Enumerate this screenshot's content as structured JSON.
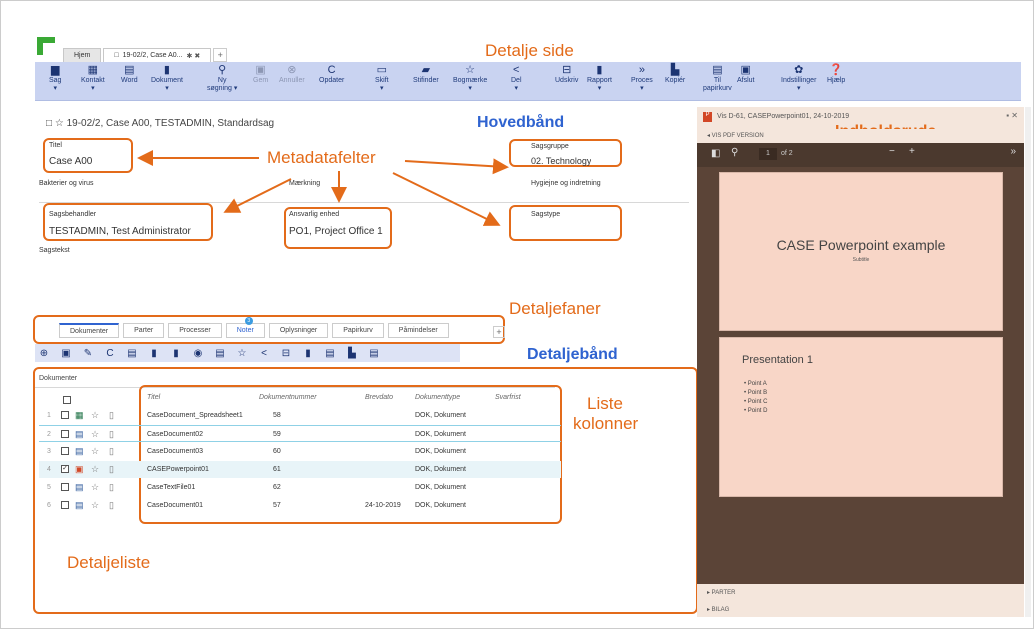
{
  "tabs": {
    "home": "Hjem",
    "active": "19-02/2, Case A0...",
    "pin": "✱ ✖",
    "add": "+"
  },
  "callouts": {
    "detail_page": "Detalje side",
    "main_band": "Hovedbånd",
    "content_pane": "Indholdsrude",
    "metadata": "Metadatafelter",
    "detail_tabs": "Detaljefaner",
    "detail_band": "Detaljebånd",
    "list_columns_1": "Liste",
    "list_columns_2": "kolonner",
    "detail_list": "Detaljeliste"
  },
  "ribbon": [
    {
      "icon": "▆",
      "label": "Sag",
      "l2": "▾"
    },
    {
      "icon": "▦",
      "label": "Kontakt",
      "l2": "▾"
    },
    {
      "icon": "▤",
      "label": "Word",
      "l2": ""
    },
    {
      "icon": "▮",
      "label": "Dokument",
      "l2": "▾"
    },
    {
      "icon": "⚲",
      "label": "Ny",
      "l2": "søgning ▾"
    },
    {
      "icon": "▣",
      "label": "Gem",
      "l2": ""
    },
    {
      "icon": "⊗",
      "label": "Annuller",
      "l2": ""
    },
    {
      "icon": "C",
      "label": "Opdater",
      "l2": ""
    },
    {
      "icon": "▭",
      "label": "Skift",
      "l2": "▾"
    },
    {
      "icon": "▰",
      "label": "Stifinder",
      "l2": ""
    },
    {
      "icon": "☆",
      "label": "Bogmærke",
      "l2": "▾"
    },
    {
      "icon": "<",
      "label": "Del",
      "l2": "▾"
    },
    {
      "icon": "⊟",
      "label": "Udskriv",
      "l2": ""
    },
    {
      "icon": "▮",
      "label": "Rapport",
      "l2": "▾"
    },
    {
      "icon": "»",
      "label": "Proces",
      "l2": "▾"
    },
    {
      "icon": "▙",
      "label": "Kopiér",
      "l2": ""
    },
    {
      "icon": "▤",
      "label": "Til",
      "l2": "papirkurv"
    },
    {
      "icon": "▣",
      "label": "Afslut",
      "l2": ""
    },
    {
      "icon": "✿",
      "label": "Indstillinger",
      "l2": "▾"
    },
    {
      "icon": "❓",
      "label": "Hjælp",
      "l2": ""
    }
  ],
  "case": {
    "folder_icon": "□",
    "star": "☆",
    "title": "19-02/2, Case A00, TESTADMIN, Standardsag"
  },
  "fields": {
    "titel_label": "Titel",
    "titel_value": "Case A00",
    "sagsgruppe_label": "Sagsgruppe",
    "sagsgruppe_value": "02. Technology",
    "bakterier": "Bakterier og virus",
    "maerkning": "Mærkning",
    "hygiejne": "Hygiejne og indretning",
    "sagsbeh_label": "Sagsbehandler",
    "sagsbeh_value": "TESTADMIN, Test Administrator",
    "ansvarlig_label": "Ansvarlig enhed",
    "ansvarlig_value": "PO1, Project Office 1",
    "sagstype_label": "Sagstype",
    "sagstekst": "Sagstekst"
  },
  "detail_tabs": [
    "Dokumenter",
    "Parter",
    "Processer",
    "Noter",
    "Oplysninger",
    "Papirkurv",
    "Påmindelser"
  ],
  "notes_badge": "3",
  "tab_add": "+",
  "detail_band_icons": [
    "⊕",
    "▣",
    "✎",
    "C",
    "▤",
    "▮",
    "▮",
    "◉",
    "▤",
    "☆",
    "<",
    "⊟",
    "▮",
    "▤",
    "▙",
    "▤"
  ],
  "list": {
    "section": "Dokumenter",
    "columns": [
      "Titel",
      "Dokumentnummer",
      "Brevdato",
      "Dokumenttype",
      "Svarfrist"
    ],
    "rows": [
      {
        "n": "1",
        "icon": "▦",
        "title": "CaseDocument_Spreadsheet1",
        "num": "58",
        "date": "",
        "type": "DOK, Dokument",
        "checked": false
      },
      {
        "n": "2",
        "icon": "▤",
        "title": "CaseDocument02",
        "num": "59",
        "date": "",
        "type": "DOK, Dokument",
        "checked": false
      },
      {
        "n": "3",
        "icon": "▤",
        "title": "CaseDocument03",
        "num": "60",
        "date": "",
        "type": "DOK, Dokument",
        "checked": false
      },
      {
        "n": "4",
        "icon": "▣",
        "title": "CASEPowerpoint01",
        "num": "61",
        "date": "",
        "type": "DOK, Dokument",
        "checked": true
      },
      {
        "n": "5",
        "icon": "▤",
        "title": "CaseTextFile01",
        "num": "62",
        "date": "",
        "type": "DOK, Dokument",
        "checked": false
      },
      {
        "n": "6",
        "icon": "▤",
        "title": "CaseDocument01",
        "num": "57",
        "date": "24-10-2019",
        "type": "DOK, Dokument",
        "checked": false
      }
    ]
  },
  "pane": {
    "title": "Vis D-61, CASEPowerpoint01, 24-10-2019",
    "pdf_version": "◂ VIS PDF VERSION",
    "page": "1",
    "of": "of 2",
    "minus": "−",
    "plus": "+",
    "next": "»",
    "slide1_title": "CASE Powerpoint example",
    "slide1_sub": "Subtitle",
    "slide2_title": "Presentation 1",
    "slide2_points": [
      "• Point A",
      "• Point B",
      "• Point C",
      "• Point D"
    ],
    "parter": "▸ PARTER",
    "bilag": "▸ BILAG"
  },
  "colors": {
    "accent": "#e36b1a",
    "blue": "#2f63d0",
    "ribbon": "#c9d3f1"
  }
}
